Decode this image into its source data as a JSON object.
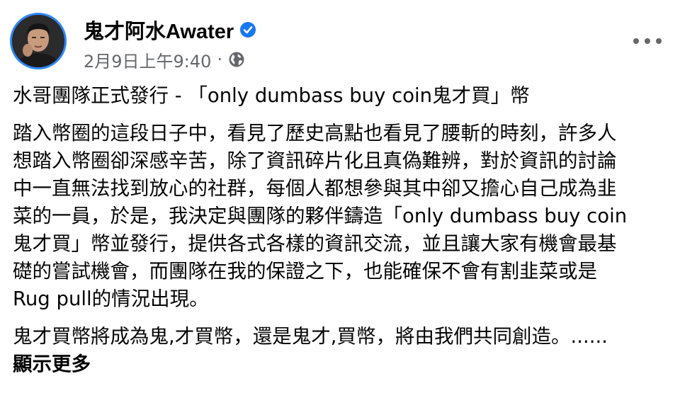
{
  "post": {
    "author": "鬼才阿水Awater",
    "verified_icon": "verified-badge-icon",
    "timestamp": "2月9日上午9:40",
    "separator": "·",
    "audience_icon": "globe-icon",
    "more_icon": "more-options-icon",
    "title": "水哥團隊正式發行 - 「only dumbass buy coin鬼才買」幣",
    "body_lines": [
      "踏入幣圈的這段日子中，看見了歷史高點也看見了腰斬的時刻，許多人",
      "想踏入幣圈卻深感辛苦，除了資訊碎片化且真偽難辨，對於資訊的討論",
      "中一直無法找到放心的社群，每個人都想參與其中卻又擔心自己成為韭",
      "菜的一員，於是，我決定與團隊的夥伴鑄造「only dumbass buy coin",
      "鬼才買」幣並發行，提供各式各樣的資訊交流，並且讓大家有機會最基",
      "礎的嘗試機會，而團隊在我的保證之下，也能確保不會有割韭菜或是",
      "Rug pull的情況出現。"
    ],
    "closing_line": "鬼才買幣將成為鬼,才買幣，還是鬼才,買幣，將由我們共同創造。......",
    "see_more": "顯示更多"
  },
  "colors": {
    "accent": "#2d88ff",
    "text": "#050505",
    "meta": "#65676b"
  }
}
